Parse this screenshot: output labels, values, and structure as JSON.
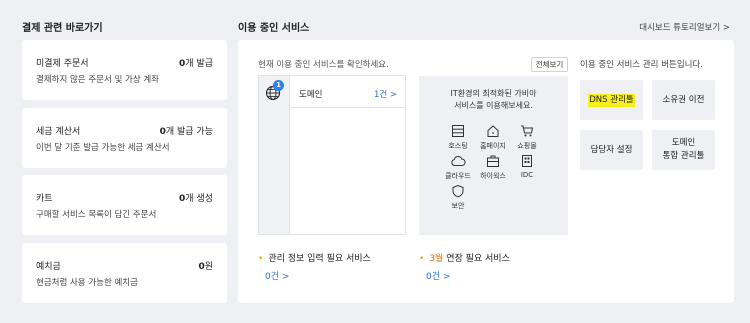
{
  "payment": {
    "title": "결제 관련 바로가기",
    "cards": [
      {
        "name": "미결제 주문서",
        "count_num": "0",
        "count_suffix": "개 발급",
        "desc": "결제하지 않은 주문서 및 가상 계좌"
      },
      {
        "name": "세금 계산서",
        "count_num": "0",
        "count_suffix": "개 발급 가능",
        "desc": "이번 달 기준 발급 가능한 세금 계산서"
      },
      {
        "name": "카트",
        "count_num": "0",
        "count_suffix": "개 생성",
        "desc": "구매할 서비스 목록이 담긴 주문서"
      },
      {
        "name": "예치금",
        "count_num": "0",
        "count_suffix": "원",
        "desc": "현금처럼 사용 가능한 예치금"
      }
    ]
  },
  "services": {
    "title": "이용 중인 서비스",
    "tutorial_link": "대시보드 튜토리얼보기 >",
    "intro": "현재 이용 중인 서비스를 확인하세요.",
    "more_label": "전체보기",
    "badge_count": "1",
    "domain_row": {
      "label": "도메인",
      "value": "1건 >"
    },
    "promo_line1": "IT환경의 최적화된 가비아",
    "promo_line2": "서비스를 이용해보세요.",
    "promo_items": [
      {
        "label": "호스팅",
        "icon": "hosting-icon"
      },
      {
        "label": "홈페이지",
        "icon": "homepage-icon"
      },
      {
        "label": "쇼핑몰",
        "icon": "shopping-cart-icon"
      },
      {
        "label": "클라우드",
        "icon": "cloud-icon"
      },
      {
        "label": "하이웍스",
        "icon": "hiworks-icon"
      },
      {
        "label": "IDC",
        "icon": "idc-icon"
      },
      {
        "label": "보안",
        "icon": "security-shield-icon"
      }
    ],
    "mgmt_note": "이용 중인 서비스 관리 버튼입니다.",
    "mgmt_buttons": [
      {
        "label": "DNS 관리툴"
      },
      {
        "label": "소유권 이전"
      },
      {
        "label": "담당자 설정"
      },
      {
        "label_line1": "도메인",
        "label_line2": "통합 관리툴"
      }
    ],
    "need_info": {
      "dot": "•",
      "label": "관리 정보 입력 필요 서비스",
      "value": "0건 >"
    },
    "need_renew": {
      "dot": "•",
      "month": "3월",
      "label": " 연장 필요 서비스",
      "value": "0건 >"
    }
  },
  "colors": {
    "accent": "#2a6fd6",
    "highlight": "#f7ef1c",
    "background": "#eef0f3"
  }
}
